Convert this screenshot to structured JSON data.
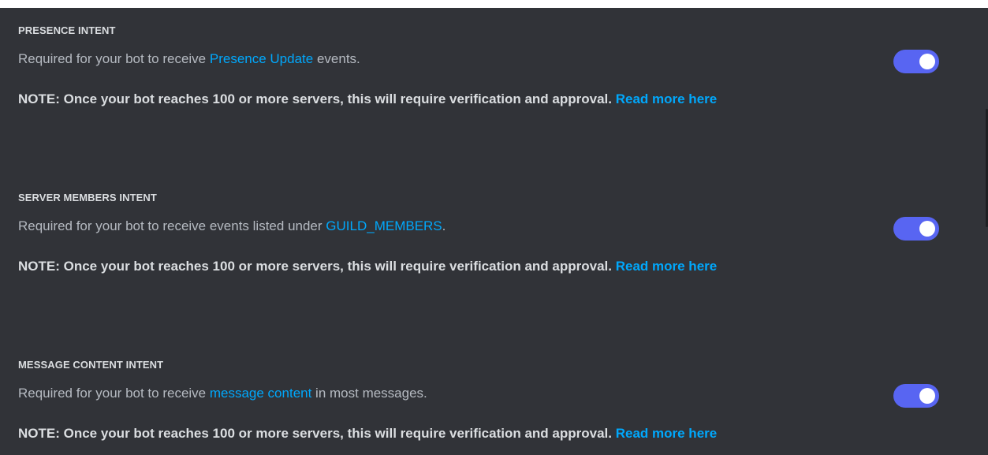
{
  "colors": {
    "background": "#313338",
    "link": "#00a8fc",
    "toggle_on": "#5865f2"
  },
  "intents": [
    {
      "heading": "PRESENCE INTENT",
      "desc_before": "Required for your bot to receive ",
      "desc_link": "Presence Update",
      "desc_after": " events.",
      "note": "NOTE: Once your bot reaches 100 or more servers, this will require verification and approval.",
      "note_link": "Read more here",
      "enabled": true
    },
    {
      "heading": "SERVER MEMBERS INTENT",
      "desc_before": "Required for your bot to receive events listed under ",
      "desc_link": "GUILD_MEMBERS",
      "desc_after": ".",
      "note": "NOTE: Once your bot reaches 100 or more servers, this will require verification and approval.",
      "note_link": "Read more here",
      "enabled": true
    },
    {
      "heading": "MESSAGE CONTENT INTENT",
      "desc_before": "Required for your bot to receive ",
      "desc_link": "message content",
      "desc_after": " in most messages.",
      "note": "NOTE: Once your bot reaches 100 or more servers, this will require verification and approval.",
      "note_link": "Read more here",
      "enabled": true
    }
  ]
}
